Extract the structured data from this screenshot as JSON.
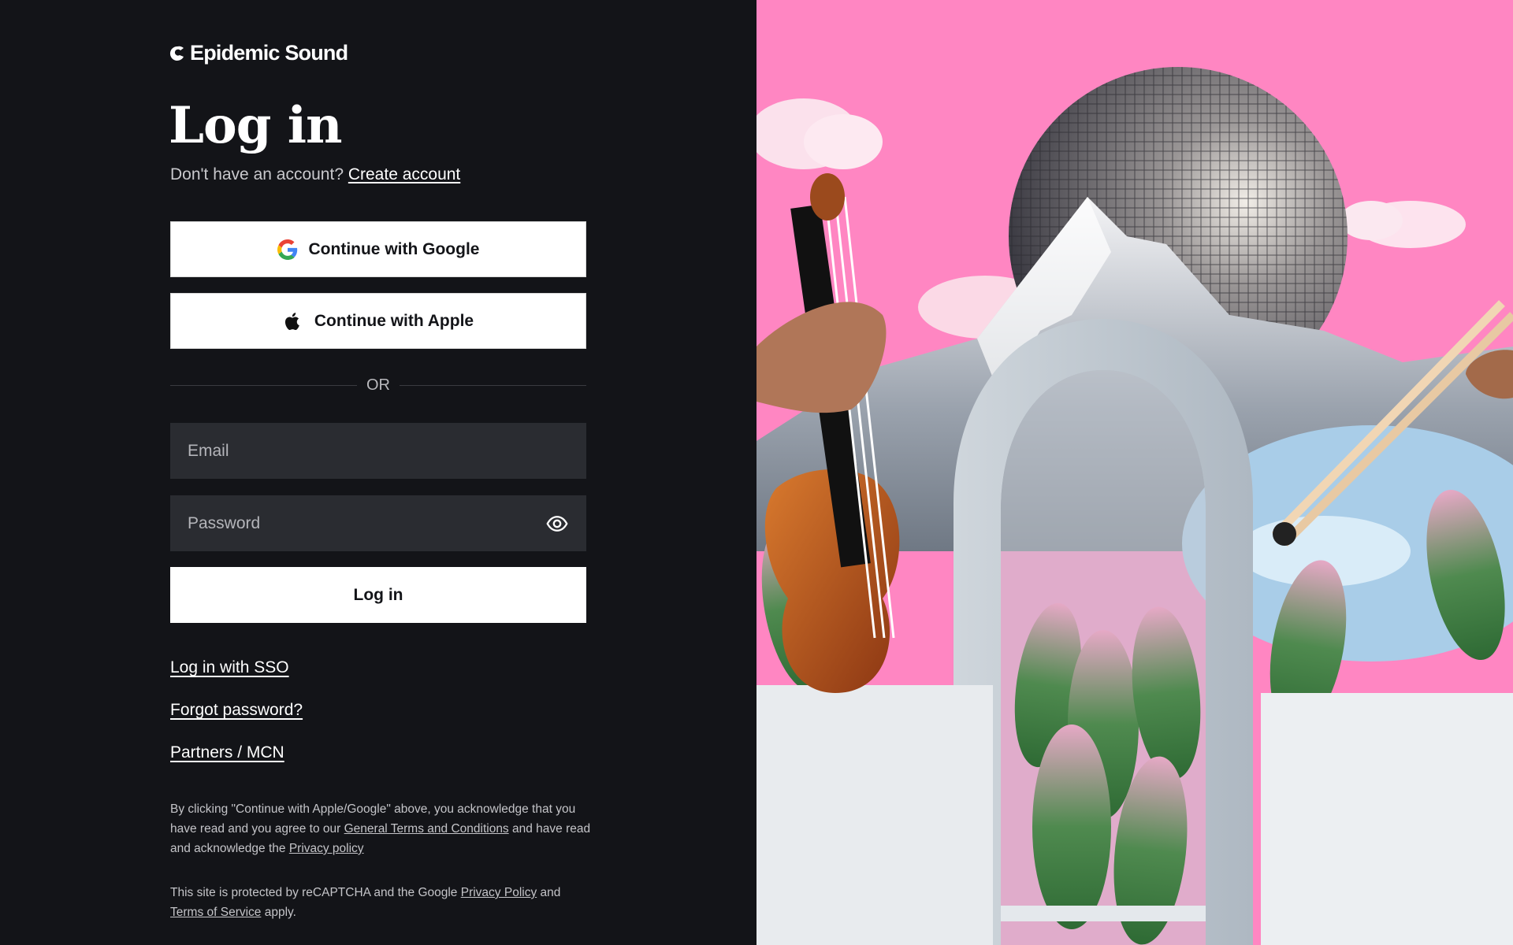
{
  "brand": {
    "name": "Epidemic Sound"
  },
  "login": {
    "title": "Log in",
    "subtitle_prefix": "Don't have an account?",
    "create_account_link": "Create account",
    "google_button": "Continue with Google",
    "apple_button": "Continue with Apple",
    "divider": "OR",
    "email_placeholder": "Email",
    "password_placeholder": "Password",
    "login_button": "Log in",
    "sso_link": "Log in with SSO",
    "forgot_link": "Forgot password?",
    "partners_link": "Partners / MCN"
  },
  "legal": {
    "ack_part1": "By clicking \"Continue with Apple/Google\" above, you acknowledge that you have read and you agree to our ",
    "terms_link": "General Terms and Conditions",
    "ack_part2": " and have read and acknowledge the ",
    "privacy_link": "Privacy policy",
    "recaptcha_part1": "This site is protected by reCAPTCHA and the Google ",
    "google_privacy_link": "Privacy Policy",
    "recaptcha_part2": " and ",
    "google_terms_link": "Terms of Service",
    "recaptcha_part3": " apply."
  },
  "colors": {
    "background": "#131418",
    "field_background": "#2a2c31",
    "hero_sky": "#ff86c2"
  },
  "hero": {
    "elements": [
      "disco-ball",
      "snowy-mountain",
      "white-arch",
      "violin-in-hand",
      "drumsticks-in-hand",
      "pink-green-leaves",
      "clouds"
    ]
  }
}
